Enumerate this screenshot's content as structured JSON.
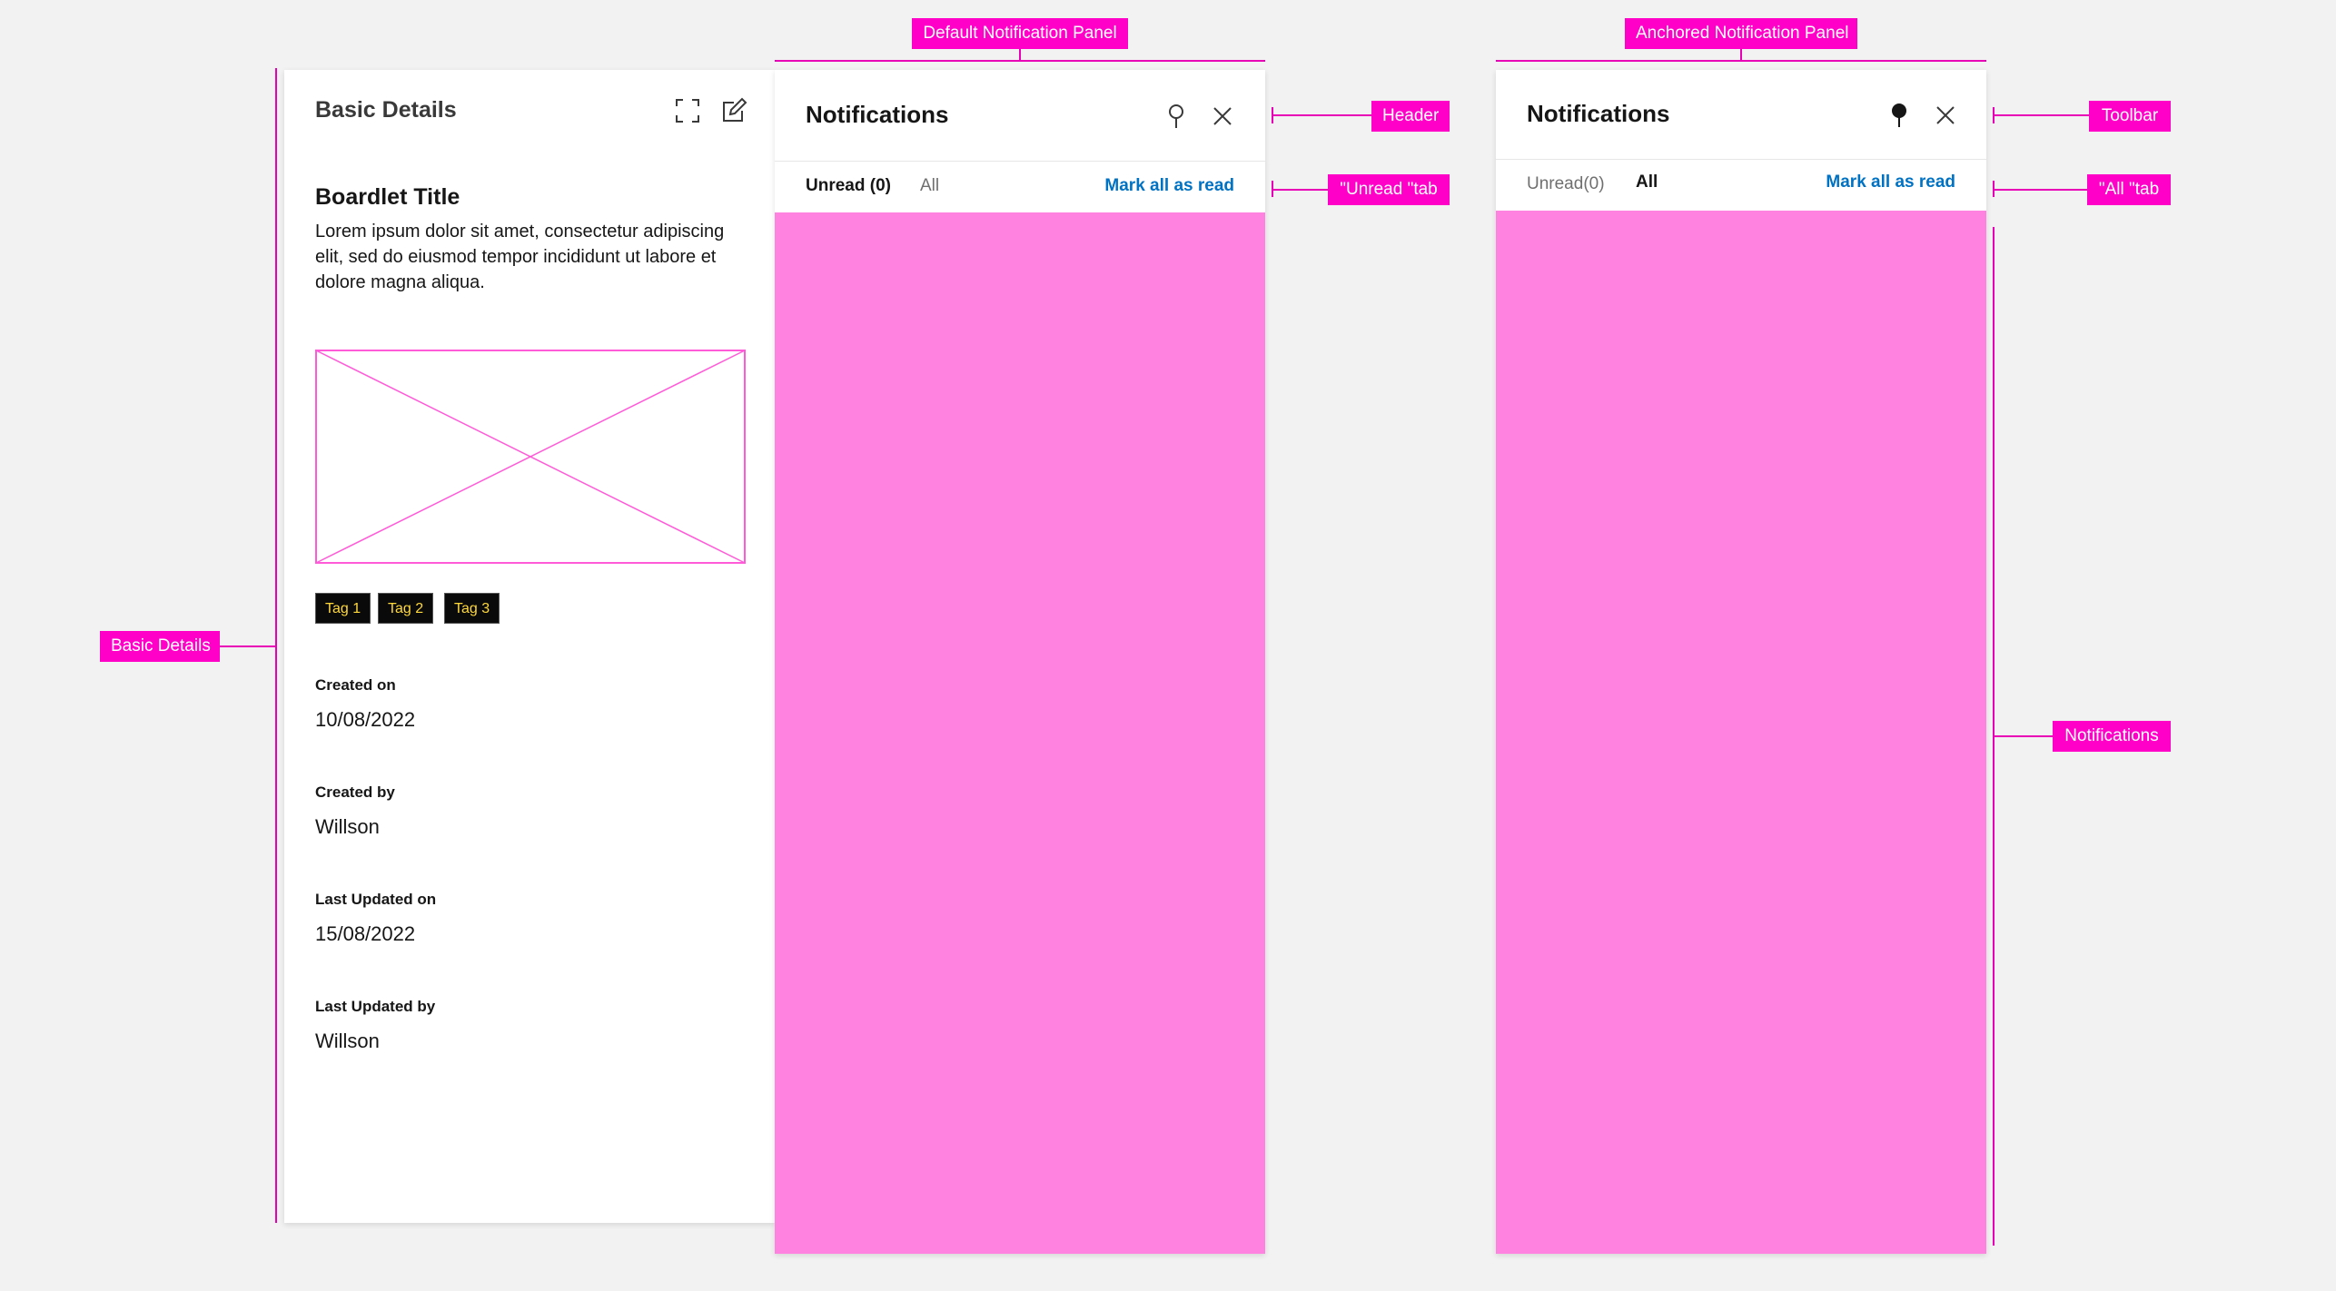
{
  "annotations": {
    "default_panel": "Default Notification Panel",
    "anchored_panel": "Anchored Notification Panel",
    "basic_details": "Basic Details",
    "header": "Header",
    "unread_tab": "\"Unread \"tab",
    "toolbar": "Toolbar",
    "all_tab": "\"All \"tab",
    "notifications": "Notifications"
  },
  "details": {
    "title": "Basic Details",
    "boardlet_title": "Boardlet Title",
    "description": "Lorem ipsum dolor sit amet, consectetur adipiscing elit, sed do eiusmod tempor incididunt ut labore et dolore magna aliqua.",
    "tags": [
      "Tag 1",
      "Tag 2",
      "Tag 3"
    ],
    "fields": [
      {
        "label": "Created on",
        "value": "10/08/2022"
      },
      {
        "label": "Created by",
        "value": "Willson"
      },
      {
        "label": "Last Updated on",
        "value": "15/08/2022"
      },
      {
        "label": "Last Updated by",
        "value": "Willson"
      }
    ]
  },
  "default_panel": {
    "title": "Notifications",
    "tab_unread": "Unread (0)",
    "tab_all": "All",
    "mark_all": "Mark all as read"
  },
  "anchored_panel": {
    "title": "Notifications",
    "tab_unread": "Unread(0)",
    "tab_all": "All",
    "mark_all": "Mark all as read"
  },
  "colors": {
    "annotation": "#ff00c8",
    "placeholder": "#ff82e0",
    "link": "#0072c3",
    "tag_bg": "#0a0a0a",
    "tag_text": "#ffd83a"
  }
}
